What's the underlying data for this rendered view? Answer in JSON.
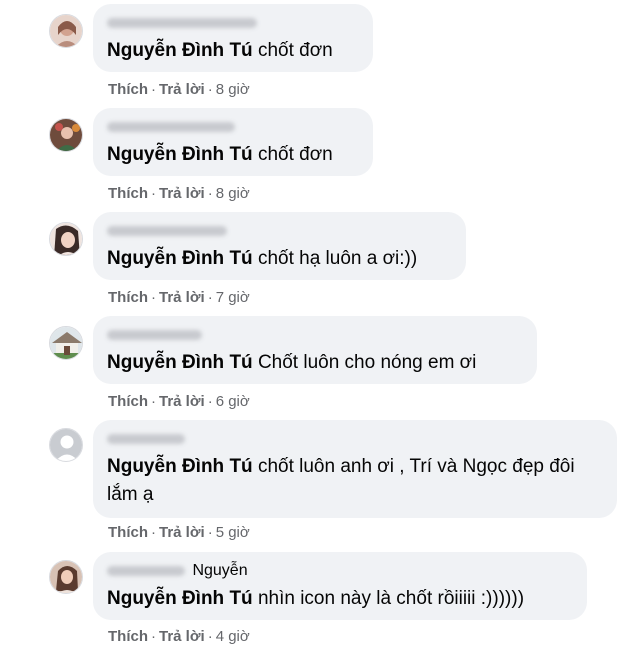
{
  "comments": [
    {
      "author_visible": "",
      "mention": "Nguyễn Đình Tú",
      "text": "chốt đơn",
      "like_label": "Thích",
      "reply_label": "Trả lời",
      "time": "8 giờ",
      "avatar_color": "#d9b8a8"
    },
    {
      "author_visible": "",
      "mention": "Nguyễn Đình Tú",
      "text": "chốt đơn",
      "like_label": "Thích",
      "reply_label": "Trả lời",
      "time": "8 giờ",
      "avatar_color": "#9a6a55"
    },
    {
      "author_visible": "",
      "mention": "Nguyễn Đình Tú",
      "text": "chốt hạ luôn a ơi:))",
      "like_label": "Thích",
      "reply_label": "Trả lời",
      "time": "7 giờ",
      "avatar_color": "#d8c3ba"
    },
    {
      "author_visible": "",
      "mention": "Nguyễn Đình Tú",
      "text": "Chốt luôn cho nóng em ơi",
      "like_label": "Thích",
      "reply_label": "Trả lời",
      "time": "6 giờ",
      "avatar_color": "#7e9a72"
    },
    {
      "author_visible": "",
      "mention": "Nguyễn Đình Tú",
      "text": "chốt luôn anh ơi , Trí và Ngọc đẹp đôi lắm ạ",
      "like_label": "Thích",
      "reply_label": "Trả lời",
      "time": "5 giờ",
      "avatar_color": "#c9ccd1"
    },
    {
      "author_visible": "Nguyễn",
      "mention": "Nguyễn Đình Tú",
      "text": "nhìn icon này là chốt rồiiiii :))))))",
      "like_label": "Thích",
      "reply_label": "Trả lời",
      "time": "4 giờ",
      "avatar_color": "#c7a48c"
    }
  ]
}
